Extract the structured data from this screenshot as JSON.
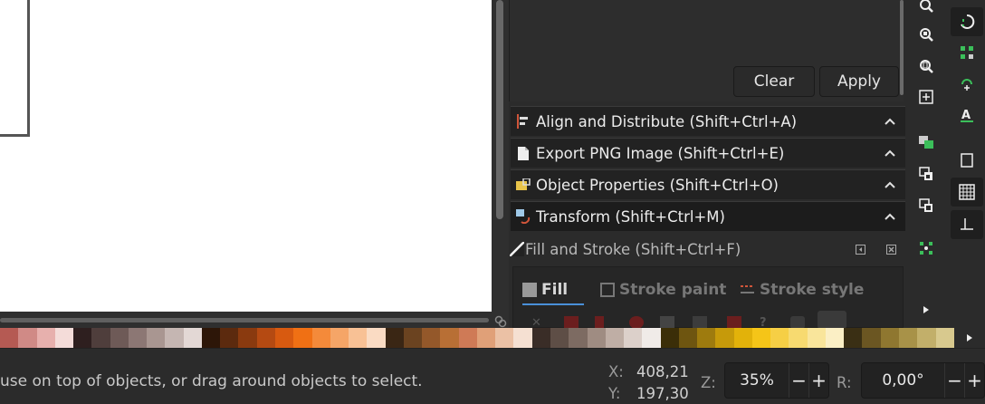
{
  "filter_panel": {
    "clear_label": "Clear",
    "apply_label": "Apply"
  },
  "dock": [
    {
      "label": "Align and Distribute (Shift+Ctrl+A)",
      "icon": "align-icon"
    },
    {
      "label": "Export PNG Image (Shift+Ctrl+E)",
      "icon": "export-icon"
    },
    {
      "label": "Object Properties (Shift+Ctrl+O)",
      "icon": "object-properties-icon"
    },
    {
      "label": "Transform (Shift+Ctrl+M)",
      "icon": "transform-icon"
    }
  ],
  "fill_stroke": {
    "title": "Fill and Stroke (Shift+Ctrl+F)",
    "tabs": [
      "Fill",
      "Stroke paint",
      "Stroke style"
    ]
  },
  "status": {
    "message": "use on top of objects, or drag around objects to select.",
    "x_label": "X:",
    "x_value": "408,21",
    "y_label": "Y:",
    "y_value": "197,30",
    "zoom_label": "Z:",
    "zoom_value": "35%",
    "rotate_label": "R:",
    "rotate_value": "0,00°",
    "minus": "−",
    "plus": "+"
  },
  "palette_colors": [
    "#b55a53",
    "#d08a86",
    "#e7b0ad",
    "#f4dcd9",
    "#2e1f1f",
    "#4f3e3c",
    "#6e5a57",
    "#8c7774",
    "#a99691",
    "#c5b6b2",
    "#e3d8d5",
    "#2d1608",
    "#5c2a0e",
    "#8a3a0f",
    "#b54a12",
    "#d85a10",
    "#f07014",
    "#f48a3a",
    "#f5a567",
    "#f8c195",
    "#fadbc3",
    "#3a2614",
    "#6b4320",
    "#94582a",
    "#b86f35",
    "#cf7a56",
    "#e0a078",
    "#ebc1a5",
    "#f5e0d2",
    "#3a2d27",
    "#5e4e46",
    "#7d6b62",
    "#9f8c82",
    "#bfaea5",
    "#dcd0ca",
    "#f0ebe8",
    "#3b2e08",
    "#6e5510",
    "#9e7b0e",
    "#c69a0a",
    "#e2b20a",
    "#f5c518",
    "#f6cf45",
    "#f7da70",
    "#f9e59b",
    "#fbefc5",
    "#3a2f14",
    "#6b5622",
    "#8f7730",
    "#a89248",
    "#c2af6a",
    "#d8c98e"
  ]
}
